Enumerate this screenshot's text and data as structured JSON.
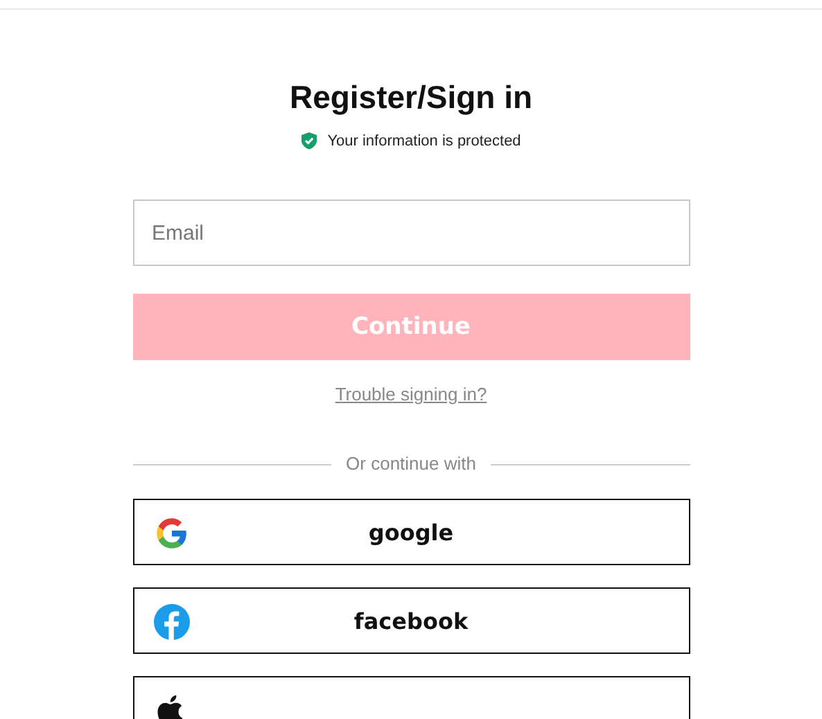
{
  "title": "Register/Sign in",
  "security_note": "Your information is protected",
  "email_field": {
    "placeholder": "Email"
  },
  "continue_button": {
    "label": "Continue",
    "disabled": true
  },
  "help_link": "Trouble signing in?",
  "divider_label": "Or continue with",
  "social_buttons": [
    {
      "kind": "google",
      "label": "google"
    },
    {
      "kind": "facebook",
      "label": "facebook"
    },
    {
      "kind": "apple"
    }
  ]
}
